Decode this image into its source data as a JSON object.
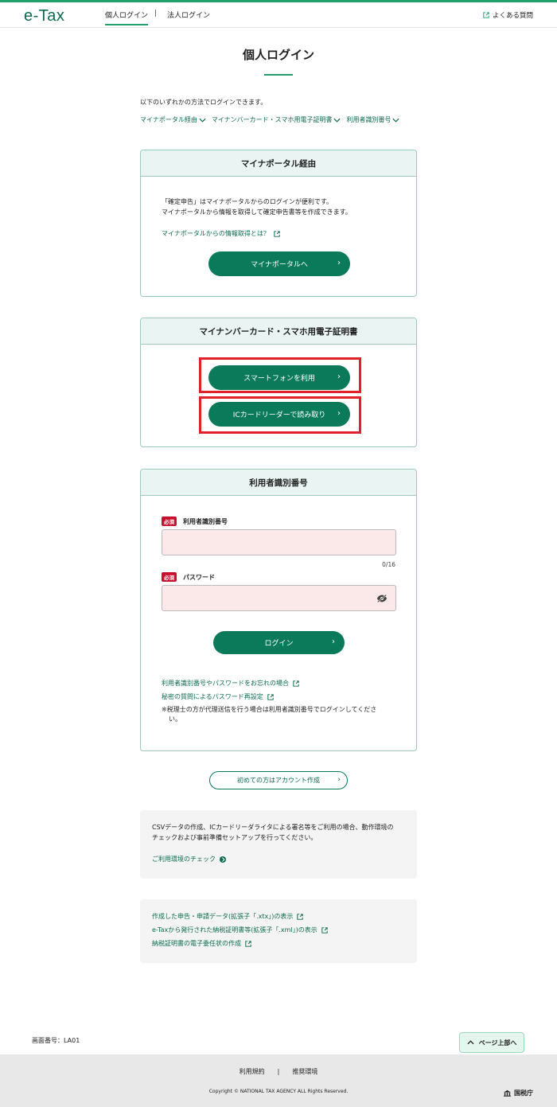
{
  "header": {
    "logo": "e-Tax",
    "nav_personal": "個人ログイン",
    "nav_separator": "|",
    "nav_corporate": "法人ログイン",
    "faq": "よくある質問"
  },
  "page": {
    "title": "個人ログイン",
    "intro": "以下のいずれかの方法でログインできます。",
    "anchors": [
      "マイナポータル経由",
      "マイナンバーカード・スマホ用電子証明書",
      "利用者識別番号"
    ]
  },
  "mynaportal_card": {
    "heading": "マイナポータル経由",
    "text_line1": "「確定申告」はマイナポータルからのログインが便利です。",
    "text_line2": "マイナポータルから情報を取得して確定申告書等を作成できます。",
    "info_link": "マイナポータルからの情報取得とは？",
    "button": "マイナポータルへ"
  },
  "mynumber_card": {
    "heading": "マイナンバーカード・スマホ用電子証明書",
    "smartphone_button": "スマートフォンを利用",
    "icreader_button": "ICカードリーダーで読み取り"
  },
  "userid_card": {
    "heading": "利用者識別番号",
    "required_badge": "必須",
    "userid_label": "利用者識別番号",
    "userid_value": "",
    "counter": "0/16",
    "password_label": "パスワード",
    "password_value": "",
    "login_button": "ログイン",
    "forgot_link": "利用者識別番号やパスワードをお忘れの場合",
    "reset_link": "秘密の質問によるパスワード再設定",
    "note_line1": "※税理士の方が代理送信を行う場合は利用者識別番号でログインしてくださ",
    "note_line2": "い。"
  },
  "account_button": "初めての方はアカウント作成",
  "env_box": {
    "text_line1": "CSVデータの作成、ICカードリーダライタによる署名等をご利用の場合、動作環境の",
    "text_line2": "チェックおよび事前準備セットアップを行ってください。",
    "link": "ご利用環境のチェック"
  },
  "links_box": {
    "links": [
      "作成した申告・申請データ(拡張子「.xtx」)の表示",
      "e-Taxから発行された納税証明書等(拡張子「.xml」)の表示",
      "納税証明書の電子委任状の作成"
    ]
  },
  "screen_number": "画面番号：LA01",
  "to_top": "ページ上部へ",
  "footer": {
    "terms": "利用規約",
    "separator": "|",
    "env": "推奨環境",
    "copyright": "Copyright © NATIONAL TAX AGENCY ALL Rights Reserved.",
    "agency": "国税庁"
  },
  "colors": {
    "accent": "#22a06b",
    "primary_button": "#0b7a5a",
    "highlight": "#e0202c",
    "required": "#c8102e",
    "field_bg": "#fbe8e9"
  }
}
